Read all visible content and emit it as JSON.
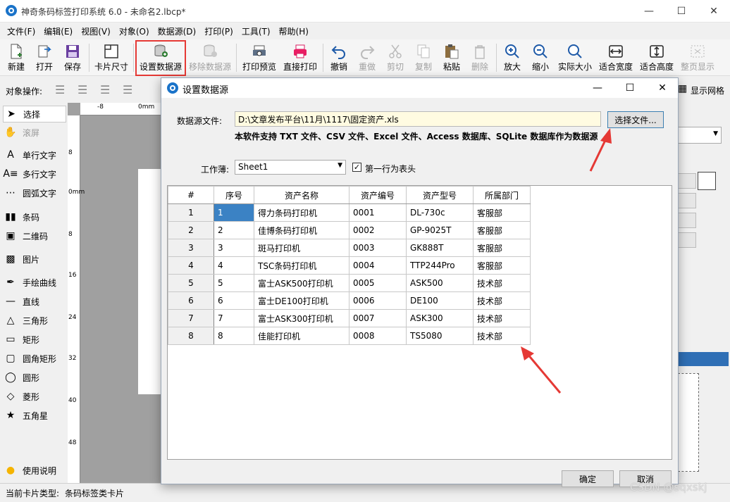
{
  "window": {
    "title": "神奇条码标签打印系统 6.0 - 未命名2.lbcp*"
  },
  "menu": [
    "文件(F)",
    "编辑(E)",
    "视图(V)",
    "对象(O)",
    "数据源(D)",
    "打印(P)",
    "工具(T)",
    "帮助(H)"
  ],
  "toolbar": {
    "new": "新建",
    "open": "打开",
    "save": "保存",
    "card_size": "卡片尺寸",
    "set_datasource": "设置数据源",
    "remove_datasource": "移除数据源",
    "print_preview": "打印预览",
    "direct_print": "直接打印",
    "undo": "撤销",
    "redo": "重做",
    "cut": "剪切",
    "copy": "复制",
    "paste": "粘贴",
    "delete": "删除",
    "zoom_in": "放大",
    "zoom_out": "缩小",
    "actual_size": "实际大小",
    "fit_width": "适合宽度",
    "fit_height": "适合高度",
    "full_page": "整页显示"
  },
  "objops": {
    "label": "对象操作:",
    "show_grid": "显示网格"
  },
  "tools": {
    "select": "选择",
    "scroll": "滚屏",
    "single_text": "单行文字",
    "multi_text": "多行文字",
    "arc_text": "圆弧文字",
    "barcode": "条码",
    "qrcode": "二维码",
    "image": "图片",
    "freehand": "手绘曲线",
    "line": "直线",
    "triangle": "三角形",
    "rect": "矩形",
    "round_rect": "圆角矩形",
    "ellipse": "圆形",
    "diamond": "菱形",
    "star": "五角星",
    "help": "使用说明"
  },
  "ruler": {
    "top": [
      "-8",
      "0mm"
    ],
    "left": [
      "8",
      "0mm",
      "8",
      "16",
      "24",
      "32",
      "40",
      "48"
    ]
  },
  "status": {
    "card_type_label": "当前卡片类型:",
    "card_type_value": "条码标签类卡片"
  },
  "dialog": {
    "title": "设置数据源",
    "file_label": "数据源文件:",
    "file_path": "D:\\文章发布平台\\11月\\1117\\固定资产.xls",
    "choose_file": "选择文件...",
    "support_note": "本软件支持 TXT 文件、CSV 文件、Excel 文件、Access 数据库、SQLite 数据库作为数据源",
    "sheet_label": "工作薄:",
    "sheet_value": "Sheet1",
    "first_row_header": "第一行为表头",
    "ok": "确定",
    "cancel": "取消"
  },
  "table": {
    "columns": [
      "#",
      "序号",
      "资产名称",
      "资产编号",
      "资产型号",
      "所属部门"
    ],
    "rows": [
      [
        "1",
        "1",
        "得力条码打印机",
        "0001",
        "DL-730c",
        "客服部"
      ],
      [
        "2",
        "2",
        "佳博条码打印机",
        "0002",
        "GP-9025T",
        "客服部"
      ],
      [
        "3",
        "3",
        "斑马打印机",
        "0003",
        "GK888T",
        "客服部"
      ],
      [
        "4",
        "4",
        "TSC条码打印机",
        "0004",
        "TTP244Pro",
        "客服部"
      ],
      [
        "5",
        "5",
        "富士ASK500打印机",
        "0005",
        "ASK500",
        "技术部"
      ],
      [
        "6",
        "6",
        "富士DE100打印机",
        "0006",
        "DE100",
        "技术部"
      ],
      [
        "7",
        "7",
        "富士ASK300打印机",
        "0007",
        "ASK300",
        "技术部"
      ],
      [
        "8",
        "8",
        "佳能打印机",
        "0008",
        "TS5080",
        "技术部"
      ]
    ]
  },
  "watermark": "CSDN @sqxskj",
  "colors": {
    "highlight": "#e53935",
    "selected_cell": "#3b82c4",
    "file_input_bg": "#fffbe1"
  }
}
